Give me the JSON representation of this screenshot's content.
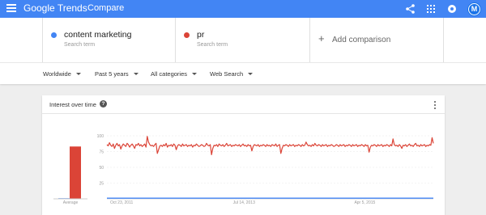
{
  "header": {
    "brand": "Google Trends",
    "page_name": "Compare",
    "avatar_letter": "M",
    "icons": [
      "menu-icon",
      "share-icon",
      "apps-grid-icon",
      "notifications-icon",
      "account-avatar"
    ]
  },
  "terms": [
    {
      "name": "content marketing",
      "subtitle": "Search term",
      "color": "#4285f4"
    },
    {
      "name": "pr",
      "subtitle": "Search term",
      "color": "#db4437"
    }
  ],
  "add_comparison": {
    "label": "Add comparison"
  },
  "filters": [
    {
      "label": "Worldwide"
    },
    {
      "label": "Past 5 years"
    },
    {
      "label": "All categories"
    },
    {
      "label": "Web Search"
    }
  ],
  "card": {
    "title": "Interest over time"
  },
  "chart_data": {
    "type": "line",
    "average_bars": {
      "label": "Average",
      "values": [
        1,
        83
      ],
      "colors": [
        "#4285f4",
        "#db4437"
      ]
    },
    "y_ticks": [
      "100",
      "75",
      "50",
      "25"
    ],
    "ylim": [
      0,
      100
    ],
    "x_tick_labels": [
      "Oct 23, 2011",
      "Jul 14, 2013",
      "Apr 5, 2015"
    ],
    "series": [
      {
        "name": "content marketing",
        "color": "#4285f4",
        "values": [
          1,
          1,
          1,
          1,
          1,
          1,
          1,
          1,
          1,
          1,
          1,
          1,
          1,
          1,
          1,
          1,
          1,
          1,
          1,
          1,
          1,
          1,
          1,
          1,
          1,
          1,
          1,
          1,
          1,
          1,
          1,
          1,
          1,
          1,
          1,
          1,
          1,
          1,
          1,
          1,
          1,
          1,
          1,
          1,
          1,
          1,
          1,
          1,
          1,
          1,
          1,
          1,
          1,
          1,
          1,
          1,
          1,
          1,
          1,
          1,
          1,
          1,
          1,
          1,
          1,
          1,
          1,
          1,
          1,
          1,
          1,
          1,
          1,
          1,
          1,
          1,
          1,
          1,
          1,
          1,
          1,
          1,
          1,
          1,
          1,
          1,
          1,
          1,
          1,
          1,
          1,
          1,
          1,
          1,
          1,
          1,
          1,
          1,
          1,
          1,
          1,
          1,
          1,
          1,
          1,
          1,
          1,
          1,
          1,
          1,
          1,
          1,
          1,
          1,
          1,
          1,
          1,
          1,
          1,
          1,
          1,
          1,
          1,
          1,
          1,
          1,
          1,
          1,
          1,
          1,
          1,
          1,
          1,
          1,
          1,
          1,
          1,
          1,
          1,
          1,
          1,
          1,
          1,
          1,
          1,
          1,
          1,
          1,
          1,
          1,
          1,
          1,
          1,
          1,
          1,
          1,
          1,
          1,
          1,
          1,
          1,
          1,
          1,
          1,
          1,
          1,
          1,
          1,
          1,
          1,
          1,
          1,
          1,
          1,
          1,
          1,
          1,
          1,
          1,
          1,
          1,
          1,
          1,
          1,
          1,
          1,
          1,
          1,
          1,
          1,
          1,
          1,
          1,
          1,
          1,
          1,
          1,
          1,
          1,
          1,
          1,
          1,
          1,
          1,
          1,
          1,
          1,
          1,
          1,
          1,
          1,
          1,
          1,
          1,
          1,
          1,
          1,
          1,
          1,
          1,
          1,
          1,
          1,
          1,
          1,
          1,
          1,
          1,
          1,
          1,
          1,
          1,
          1,
          1,
          1,
          1,
          1,
          1,
          1,
          1,
          1,
          1,
          1,
          1,
          1,
          1,
          1,
          1,
          1,
          1,
          1,
          1,
          1,
          1,
          1,
          1,
          1,
          1,
          1,
          1
        ]
      },
      {
        "name": "pr",
        "color": "#db4437",
        "values": [
          86,
          84,
          89,
          85,
          83,
          87,
          80,
          85,
          88,
          84,
          86,
          79,
          84,
          87,
          85,
          83,
          88,
          86,
          82,
          85,
          87,
          84,
          80,
          86,
          85,
          88,
          84,
          86,
          83,
          85,
          87,
          82,
          99,
          90,
          86,
          84,
          85,
          83,
          86,
          88,
          72,
          78,
          84,
          85,
          83,
          86,
          84,
          88,
          82,
          85,
          84,
          86,
          83,
          87,
          85,
          78,
          84,
          86,
          85,
          83,
          87,
          84,
          85,
          86,
          83,
          85,
          84,
          86,
          82,
          85,
          84,
          87,
          85,
          83,
          84,
          86,
          85,
          83,
          84,
          88,
          85,
          84,
          86,
          70,
          80,
          85,
          84,
          86,
          83,
          87,
          85,
          84,
          86,
          83,
          85,
          88,
          84,
          85,
          86,
          83,
          85,
          84,
          86,
          85,
          84,
          86,
          83,
          85,
          87,
          84,
          85,
          83,
          86,
          84,
          85,
          76,
          83,
          86,
          85,
          84,
          86,
          83,
          85,
          84,
          86,
          85,
          83,
          86,
          84,
          85,
          83,
          86,
          85,
          84,
          87,
          83,
          85,
          86,
          72,
          80,
          85,
          84,
          86,
          85,
          83,
          86,
          84,
          85,
          86,
          83,
          85,
          84,
          86,
          85,
          83,
          86,
          84,
          85,
          90,
          86,
          84,
          85,
          83,
          86,
          84,
          88,
          85,
          84,
          86,
          85,
          83,
          86,
          84,
          85,
          86,
          83,
          85,
          84,
          86,
          85,
          83,
          84,
          86,
          85,
          83,
          86,
          84,
          85,
          86,
          83,
          85,
          84,
          86,
          85,
          83,
          86,
          84,
          85,
          86,
          83,
          85,
          84,
          86,
          85,
          83,
          86,
          84,
          85,
          74,
          82,
          85,
          84,
          86,
          85,
          83,
          86,
          84,
          85,
          86,
          83,
          85,
          84,
          86,
          85,
          83,
          86,
          84,
          95,
          86,
          84,
          85,
          83,
          86,
          84,
          80,
          85,
          84,
          86,
          83,
          85,
          87,
          84,
          85,
          83,
          86,
          88,
          84,
          85,
          83,
          86,
          84,
          85,
          86,
          83,
          85,
          84,
          86,
          85,
          97,
          88
        ]
      }
    ]
  }
}
